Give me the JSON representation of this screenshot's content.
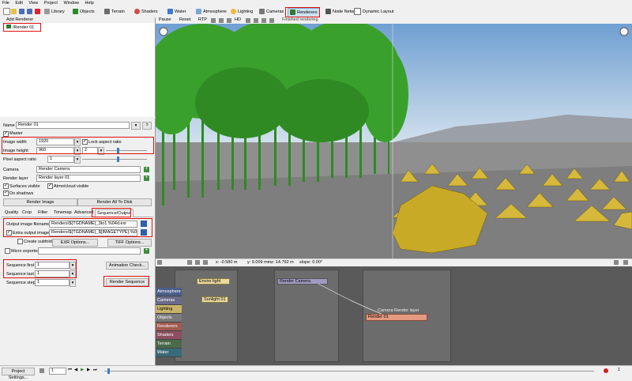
{
  "menu": [
    "File",
    "Edit",
    "View",
    "Project",
    "Window",
    "Help"
  ],
  "toolbar": {
    "library": "Library",
    "objects": "Objects",
    "terrain": "Terrain",
    "shaders": "Shaders",
    "water": "Water",
    "atmosphere": "Atmosphere",
    "lighting": "Lighting",
    "cameras": "Cameras",
    "renderers": "Renderers",
    "node_network": "Node Network",
    "dynamic_layout": "Dynamic Layout"
  },
  "left_header": {
    "add_renderer": "Add Renderer"
  },
  "render_list": [
    "/Render 01"
  ],
  "viewport_toolbar": {
    "pause": "Pause",
    "reset": "Reset",
    "rtp": "RTP",
    "hd": "HD",
    "status": "Finished rendering"
  },
  "props": {
    "name_label": "Name",
    "name_value": "Render 01",
    "master_label": "Master",
    "image_width_label": "Image width",
    "image_width_value": "1920",
    "lock_aspect_label": "Lock aspect ratio",
    "image_height_label": "Image height",
    "image_height_value": "960",
    "scale_value": "2",
    "pixel_aspect_label": "Pixel aspect ratio",
    "pixel_aspect_value": "1",
    "camera_label": "Camera",
    "camera_value": "Render Camera",
    "render_layer_label": "Render layer",
    "render_layer_value": "Render layer 01",
    "surfaces_visible_label": "Surfaces visible",
    "atmo_visible_label": "Atmo/cloud visible",
    "do_shadows_label": "Do shadows",
    "render_image_button": "Render Image",
    "render_all_button": "Render All To Disk"
  },
  "tabs": [
    "Quality",
    "Crop",
    "Filter",
    "Tonemap",
    "Advanced",
    "Sequence/Output"
  ],
  "sequence": {
    "output_filename_label": "Output image filename",
    "output_filename_value": "Renders\\${TGDNAME}_3to1.%04d.exr",
    "extra_output_label": "Extra output images",
    "extra_output_value": "Renders\\${TGDNAME}_${IMAGETYPE}.%04d.exr",
    "create_subfolders_label": "Create subfolders",
    "exr_options_button": "EXR Options...",
    "tiff_options_button": "TIFF Options...",
    "micro_exporter_label": "Micro exporter",
    "animation_check_button": "Animation Check...",
    "seq_first_label": "Sequence first",
    "seq_first_value": "1",
    "seq_last_label": "Sequence last",
    "seq_last_value": "1",
    "seq_step_label": "Sequence step",
    "seq_step_value": "1",
    "render_sequence_button": "Render Sequence"
  },
  "viewport_status": {
    "x": "x: -0.580 m",
    "y": "y: 9.009 mm",
    "z": "z: 14.792 m",
    "slope": "slope: 0.00°"
  },
  "nodes": {
    "sidebar": [
      "Atmosphere",
      "Cameras",
      "Lighting",
      "Objects",
      "Renderers",
      "Shaders",
      "Terrain",
      "Water"
    ],
    "enviro_light": "Enviro light",
    "sunlight": "Sunlight 01",
    "render_camera": "Render Camera",
    "render_node": "Render 01",
    "render_port_camera": "Camera",
    "render_port_layer": "Render layer"
  },
  "statusbar": {
    "project_settings": "Project Settings...",
    "frame_value": "1",
    "frame_end": "1"
  },
  "colors": {
    "highlight_red": "#e01010",
    "sky_top": "#7ea9d6",
    "ground": "#8c8c8c",
    "tree_green": "#2e8b22"
  }
}
